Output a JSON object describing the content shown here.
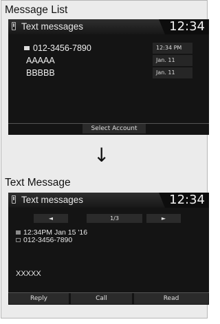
{
  "top": {
    "caption": "Message List",
    "title": "Text messages",
    "clock": "12:34",
    "rows": [
      {
        "text": "012-3456-7890",
        "date": "12:34 PM"
      },
      {
        "text": "AAAAA",
        "date": "Jan. 11"
      },
      {
        "text": "BBBBB",
        "date": "Jan. 11"
      }
    ],
    "select_account": "Select Account"
  },
  "arrow": "↓",
  "bottom": {
    "caption": "Text Message",
    "title": "Text messages",
    "clock": "12:34",
    "prev": "◄",
    "page": "1/3",
    "next": "►",
    "timestamp": "12:34PM Jan 15 '16",
    "sender": "012-3456-7890",
    "body": "XXXXX",
    "buttons": {
      "reply": "Reply",
      "call": "Call",
      "read": "Read"
    }
  }
}
